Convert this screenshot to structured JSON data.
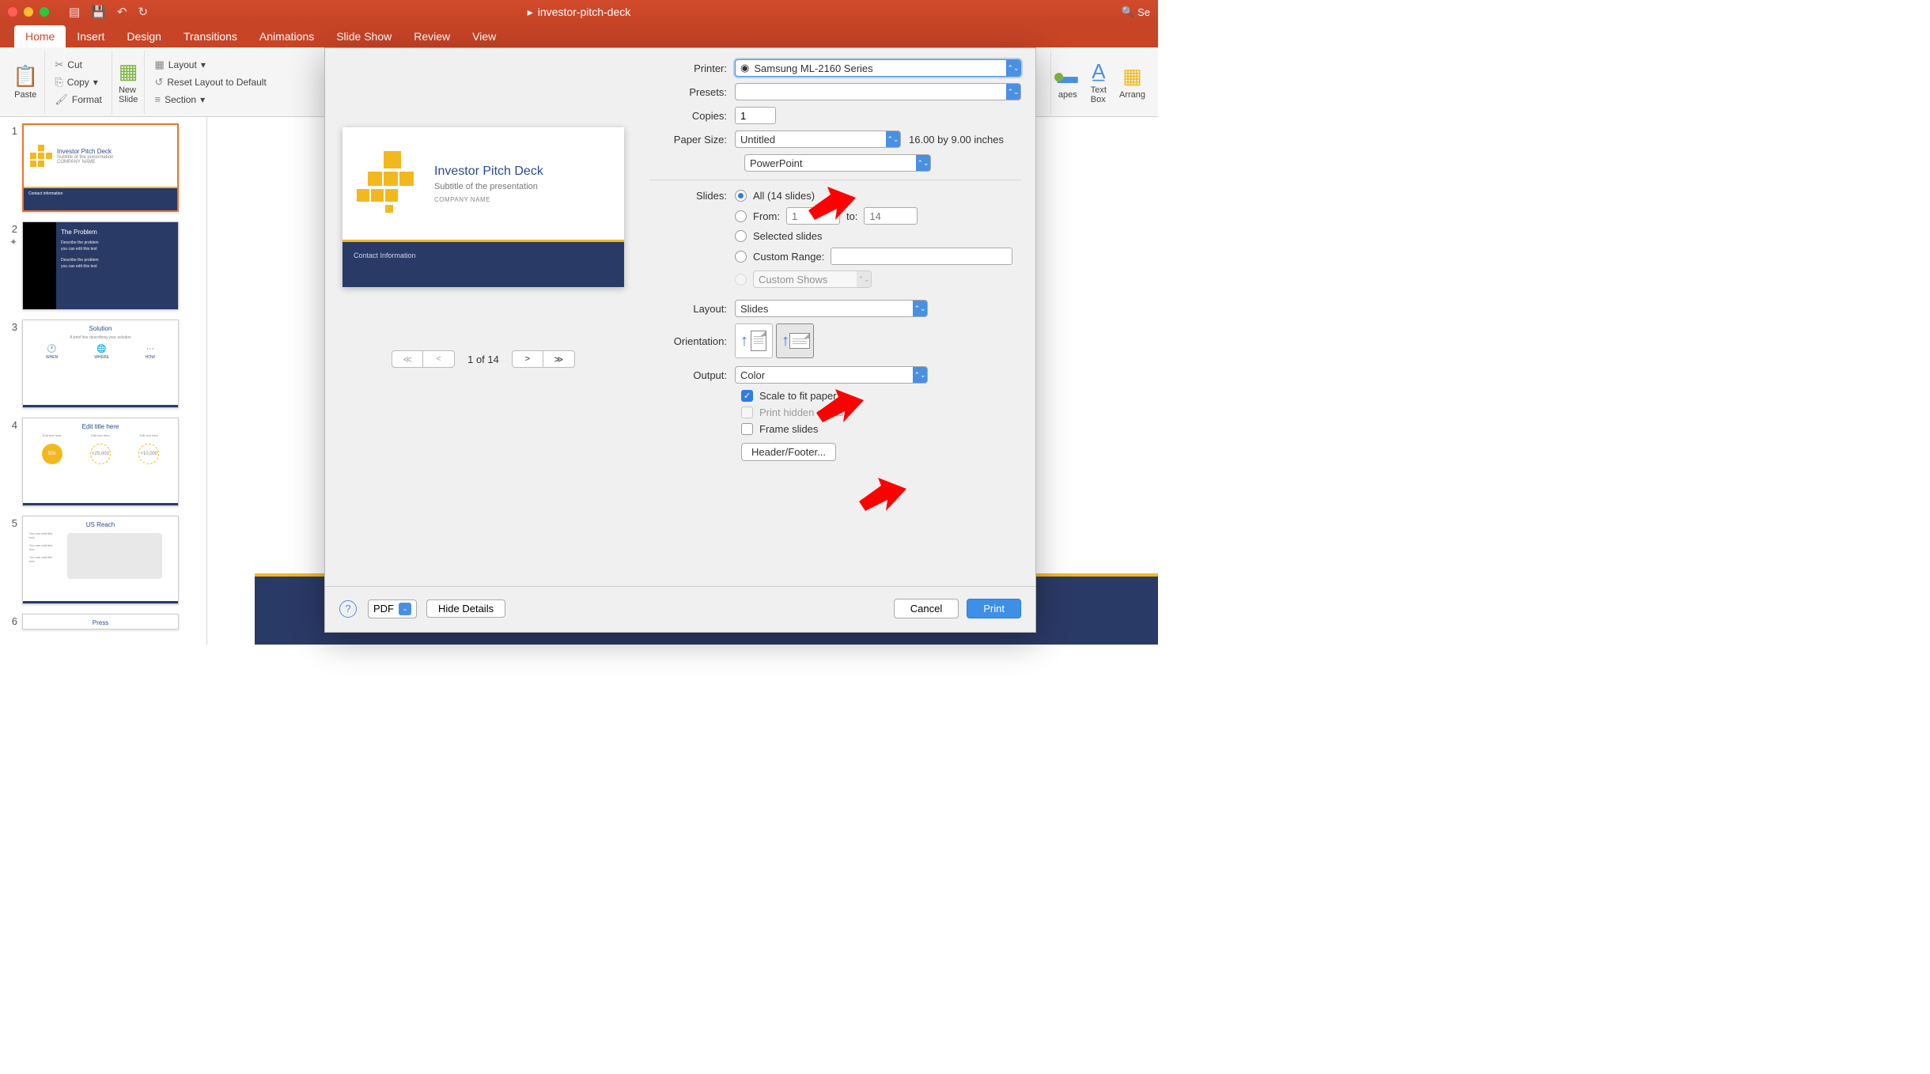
{
  "window": {
    "title": "investor-pitch-deck",
    "search_placeholder": "Se"
  },
  "tabs": [
    "Home",
    "Insert",
    "Design",
    "Transitions",
    "Animations",
    "Slide Show",
    "Review",
    "View"
  ],
  "ribbon": {
    "paste": "Paste",
    "cut": "Cut",
    "copy": "Copy",
    "format": "Format",
    "new_slide": "New\nSlide",
    "layout": "Layout",
    "reset": "Reset Layout to Default",
    "section": "Section",
    "shapes": "apes",
    "textbox": "Text\nBox",
    "arrange": "Arrang"
  },
  "thumbs": {
    "t1_title": "Investor Pitch Deck",
    "t1_sub": "Subtitle of the presentation",
    "t1_company": "COMPANY NAME",
    "t1_footer": "Contact information",
    "t2_h": "The Problem",
    "t2_p1": "Describe the problem",
    "t2_p2": "you can edit this text",
    "t3_h": "Solution",
    "t3_sub": "A brief line describing your solution",
    "t3_when": "WHEN",
    "t3_where": "WHERE",
    "t3_how": "HOW",
    "t4_h": "Edit title here",
    "t4_sub": "Edit text here",
    "t4_c1": "50k",
    "t4_c2": "+25,000",
    "t4_c3": "+10,000",
    "t5_h": "US Reach",
    "t5_edit": "You can edit this text",
    "t6_h": "Press"
  },
  "preview": {
    "title": "Investor Pitch Deck",
    "subtitle": "Subtitle of the presentation",
    "company": "COMPANY NAME",
    "footer": "Contact Information",
    "pager": "1 of 14"
  },
  "dlg": {
    "printer_label": "Printer:",
    "printer_value": "Samsung ML-2160 Series",
    "presets_label": "Presets:",
    "presets_value": "",
    "copies_label": "Copies:",
    "copies_value": "1",
    "papersize_label": "Paper Size:",
    "papersize_value": "Untitled",
    "papersize_note": "16.00 by 9.00 inches",
    "app_select": "PowerPoint",
    "slides_label": "Slides:",
    "all_label": "All  (14 slides)",
    "from_label": "From:",
    "from_value": "1",
    "to_label": "to:",
    "to_value": "14",
    "selected_label": "Selected slides",
    "custom_range_label": "Custom Range:",
    "custom_shows_label": "Custom Shows",
    "layout_label": "Layout:",
    "layout_value": "Slides",
    "orientation_label": "Orientation:",
    "output_label": "Output:",
    "output_value": "Color",
    "scale_label": "Scale to fit paper",
    "hidden_label": "Print hidden slides",
    "frame_label": "Frame slides",
    "header_footer_btn": "Header/Footer...",
    "pdf_btn": "PDF",
    "hide_details_btn": "Hide Details",
    "cancel_btn": "Cancel",
    "print_btn": "Print"
  }
}
